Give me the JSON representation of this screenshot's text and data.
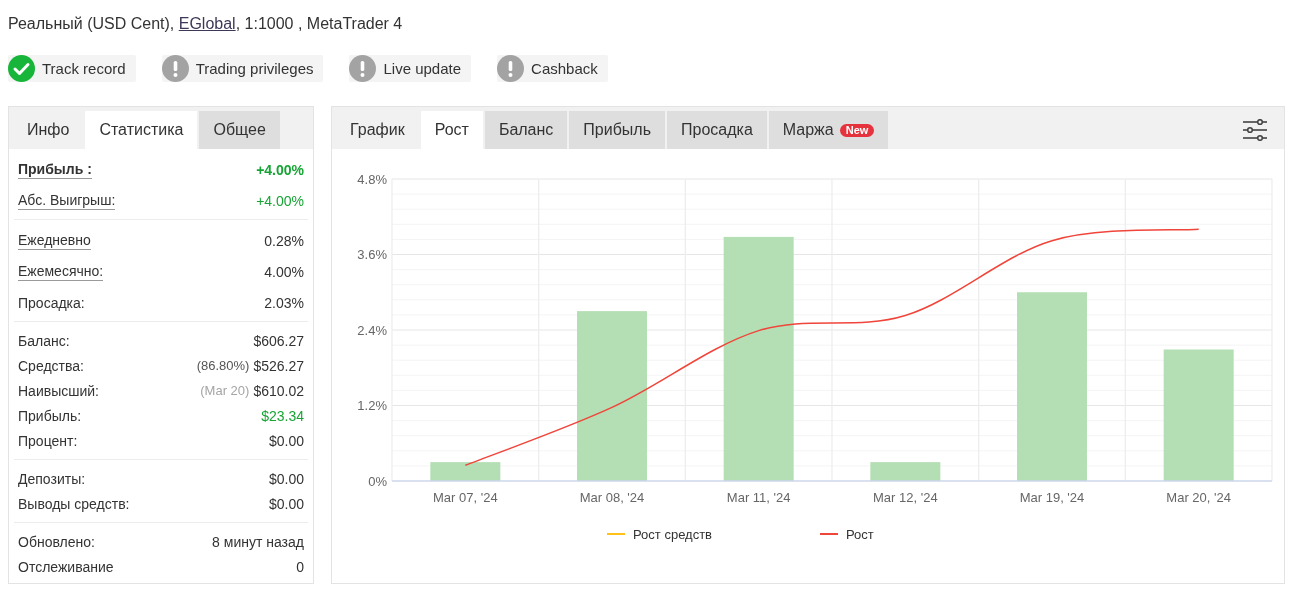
{
  "header": {
    "before": "Реальный (USD Cent), ",
    "link": "EGlobal",
    "after": ", 1:1000 , MetaTrader 4"
  },
  "badges": [
    {
      "label": "Track record",
      "verified": true
    },
    {
      "label": "Trading privileges",
      "verified": false
    },
    {
      "label": "Live update",
      "verified": false
    },
    {
      "label": "Cashback",
      "verified": false
    }
  ],
  "stats_panel": {
    "tabs": [
      {
        "label": "Инфо",
        "selected": false,
        "kind": "plain"
      },
      {
        "label": "Статистика",
        "selected": true,
        "kind": "plain"
      },
      {
        "label": "Общее",
        "selected": false,
        "kind": "shaded"
      }
    ],
    "groups": [
      {
        "rows": [
          {
            "label": "Прибыль :",
            "value": "+4.00%",
            "underlined": true,
            "bold": true,
            "positive": true
          },
          {
            "label": "Абс. Выигрыш:",
            "value": "+4.00%",
            "underlined": true,
            "bold": false,
            "positive": true
          }
        ]
      },
      {
        "rows": [
          {
            "label": "Ежедневно",
            "value": "0.28%",
            "underlined": true,
            "bold": false,
            "positive": false
          },
          {
            "label": "Ежемесячно:",
            "value": "4.00%",
            "underlined": true,
            "bold": false,
            "positive": false
          },
          {
            "label": "Просадка:",
            "value": "2.03%",
            "underlined": false,
            "bold": false,
            "positive": false
          }
        ]
      },
      {
        "rows": [
          {
            "label": "Баланс:",
            "value": "$606.27",
            "underlined": false,
            "bold": false,
            "positive": false
          },
          {
            "label": "Средства:",
            "value": "$526.27",
            "note": "(86.80%)",
            "note_muted": false,
            "underlined": false,
            "bold": false,
            "positive": false
          },
          {
            "label": "Наивысший:",
            "value": "$610.02",
            "note": "(Mar 20)",
            "note_muted": true,
            "underlined": false,
            "bold": false,
            "positive": false
          },
          {
            "label": "Прибыль:",
            "value": "$23.34",
            "underlined": false,
            "bold": false,
            "positive": true
          },
          {
            "label": "Процент:",
            "value": "$0.00",
            "underlined": false,
            "bold": false,
            "positive": false
          }
        ]
      },
      {
        "rows": [
          {
            "label": "Депозиты:",
            "value": "$0.00",
            "underlined": false,
            "bold": false,
            "positive": false
          },
          {
            "label": "Выводы средств:",
            "value": "$0.00",
            "underlined": false,
            "bold": false,
            "positive": false
          }
        ]
      },
      {
        "rows": [
          {
            "label": "Обновлено:",
            "value": "8 минут назад",
            "underlined": false,
            "bold": false,
            "positive": false
          },
          {
            "label": "Отслеживание",
            "value": "0",
            "underlined": false,
            "bold": false,
            "positive": false
          }
        ]
      }
    ]
  },
  "chart_panel": {
    "tabs": [
      {
        "label": "График",
        "selected": false,
        "kind": "plain"
      },
      {
        "label": "Рост",
        "selected": true,
        "kind": "plain"
      },
      {
        "label": "Баланс",
        "selected": false,
        "kind": "shaded"
      },
      {
        "label": "Прибыль",
        "selected": false,
        "kind": "shaded"
      },
      {
        "label": "Просадка",
        "selected": false,
        "kind": "shaded"
      },
      {
        "label": "Маржа",
        "selected": false,
        "kind": "shaded",
        "badge": "New"
      }
    ],
    "chart_data": {
      "type": "bar",
      "categories": [
        "Mar 07, '24",
        "Mar 08, '24",
        "Mar 11, '24",
        "Mar 12, '24",
        "Mar 19, '24",
        "Mar 20, '24"
      ],
      "series": [
        {
          "color": "#b4dfb4",
          "values": [
            0.3,
            2.7,
            3.88,
            0.3,
            3.0,
            2.09
          ]
        },
        {
          "name": "Рост средств",
          "type": "line",
          "color": "#ffc21a",
          "values": [
            null,
            null,
            null,
            null,
            null,
            null
          ]
        },
        {
          "name": "Рост",
          "type": "line",
          "color": "#f0453a",
          "values": [
            0.25,
            1.17,
            2.39,
            2.63,
            3.82,
            4.0
          ]
        }
      ],
      "ylim": [
        0,
        4.8
      ],
      "yticks": [
        {
          "value": 0,
          "label": "0%"
        },
        {
          "value": 1.2,
          "label": "1.2%"
        },
        {
          "value": 2.4,
          "label": "2.4%"
        },
        {
          "value": 3.6,
          "label": "3.6%"
        },
        {
          "value": 4.8,
          "label": "4.8%"
        }
      ],
      "grid": true
    }
  }
}
